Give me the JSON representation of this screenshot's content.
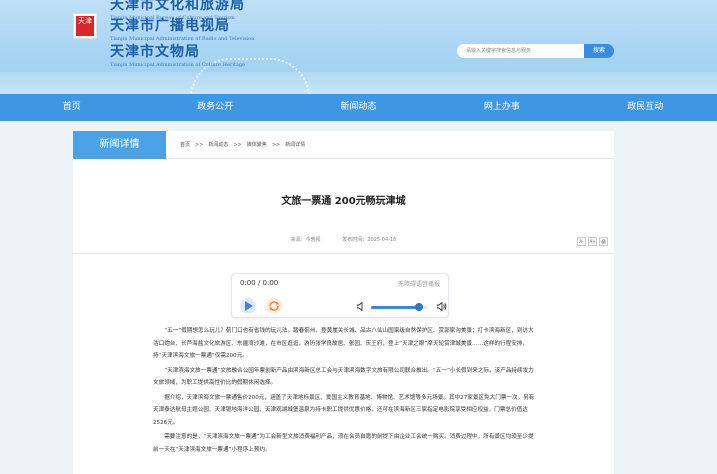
{
  "header": {
    "seal_text": "天津",
    "bureaus": [
      {
        "cn": "天津市文化和旅游局",
        "en": "Tianjin Municipal Bureau of Culture and Tourism"
      },
      {
        "cn": "天津市广播电视局",
        "en": "Tianjin Municipal Administration of Radio and Television"
      },
      {
        "cn": "天津市文物局",
        "en": "Tianjin Municipal Administration of Culture Heritage"
      }
    ],
    "search_placeholder": "请输入关键字搜索信息与服务",
    "search_button": "搜索"
  },
  "nav": [
    "首页",
    "政务公开",
    "新闻动态",
    "网上办事",
    "政民互动"
  ],
  "tab_title": "新闻详情",
  "breadcrumb": [
    "首页",
    ">>",
    "新闻动态",
    ">>",
    "媒体聚焦",
    ">>",
    "新闻详情"
  ],
  "article": {
    "title": "文旅一票通 200元畅玩津城",
    "source": "来源：今晚报",
    "date": "发布时间：2025-04-16",
    "tools": [
      "A-",
      "A+",
      "🖨"
    ],
    "paragraphs": [
      "“五一”假期想怎么玩儿？蓟门口也有省钱的玩儿法。踏春蓟州，登黄崖关长城、品古八仙山国家级自然保护区、赏郭家沟美景；打卡滨海新区，到访大沽口炮台、长芦海盐文化旅游区、东疆湾沙滩，在市区逛逛，游历张学良故居、张园、庆王府，登上“天津之眼”摩天轮赏津城美景……这样的行程安排，持“天津滨海文旅一票通”仅需200元。",
      "“天津滨海文旅一票通”文旅融合公园年票创新产品由滨海新区总工会与天津滨海数字文旅有限公司联合推出。“五一”小长假到来之际，该产品持续发力文旅领域，为职工提供高性价比的假期休闲选择。",
      "据介绍，天津滨海文旅一票通售价200元，涵盖了天津地标景区、爱国主义教育基地、博物馆、艺术馆等多元场景。其中27家景区免大门票一次，另有天津泰达航母主题公园、天津银地海洋公园、天津观湖城堡温泉为持卡职工提供优惠价格，还可在滨海新区三家指定电影院享受相应权益，门票总价值达2526元。",
      "需要注意的是，“天津滨海文旅一票通”为工会新型文旅消费福利产品，须在会员自愿的前提下由企业工会统一购买。消费过程中，所有景区均须至少提前一天在“天津滨海文旅一票通”小程序上预约。"
    ]
  },
  "player": {
    "time": "0:00 / 0:00",
    "label": "无障碍语音播报",
    "volume_fraction": 0.85,
    "accent_color": "#3c86e0"
  }
}
